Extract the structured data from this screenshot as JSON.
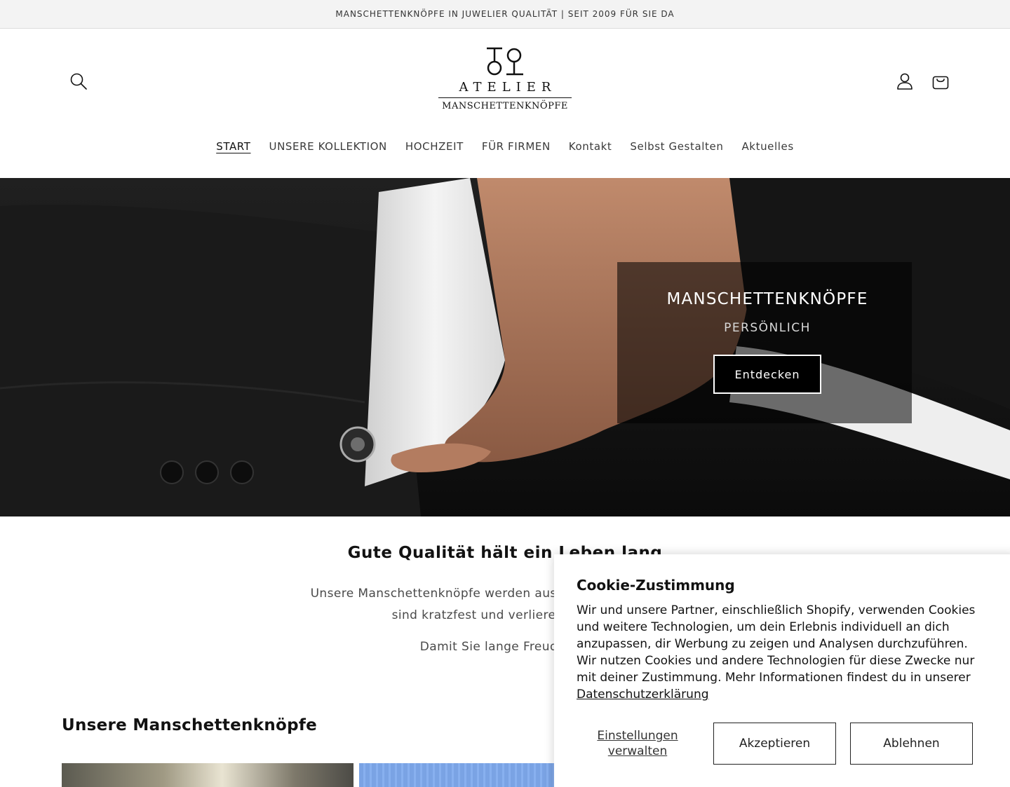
{
  "announcement": {
    "text": "MANSCHETTENKNÖPFE IN JUWELIER QUALITÄT | SEIT 2009 FÜR SIE DA"
  },
  "header": {
    "logo": {
      "word": "ATELIER",
      "sub": "MANSCHETTENKNÖPFE"
    },
    "icons": {
      "search": "search-icon",
      "account": "user-icon",
      "cart": "shopping-bag-icon"
    }
  },
  "nav": {
    "items": [
      {
        "label": "START",
        "active": true
      },
      {
        "label": "UNSERE KOLLEKTION",
        "active": false
      },
      {
        "label": "HOCHZEIT",
        "active": false
      },
      {
        "label": "FÜR FIRMEN",
        "active": false
      },
      {
        "label": "Kontakt",
        "active": false
      },
      {
        "label": "Selbst Gestalten",
        "active": false
      },
      {
        "label": "Aktuelles",
        "active": false
      }
    ]
  },
  "hero": {
    "title": "MANSCHETTENKNÖPFE",
    "subtitle": "PERSÖNLICH",
    "button_label": "Entdecken"
  },
  "intro": {
    "title": "Gute Qualität hält ein Leben lang",
    "paragraph_1_line_1": "Unsere Manschettenknöpfe werden aus hochwertigem Spiegel",
    "paragraph_1_line_2": "sind kratzfest und verlieren nicht an",
    "paragraph_2": "Damit Sie lange Freude dar"
  },
  "collection": {
    "title": "Unsere Manschettenknöpfe"
  },
  "cookie": {
    "title": "Cookie-Zustimmung",
    "text": "Wir und unsere Partner, einschließlich Shopify, verwenden Cookies und weitere Technologien, um dein Erlebnis individuell an dich anzupassen, dir Werbung zu zeigen und Analysen durchzuführen. Wir nutzen Cookies und andere Technologien für diese Zwecke nur mit deiner Zustimmung. Mehr Informationen findest du in unserer",
    "link_label": "Datenschutzerklärung",
    "manage_label": "Einstellungen verwalten",
    "accept_label": "Akzeptieren",
    "decline_label": "Ablehnen"
  }
}
